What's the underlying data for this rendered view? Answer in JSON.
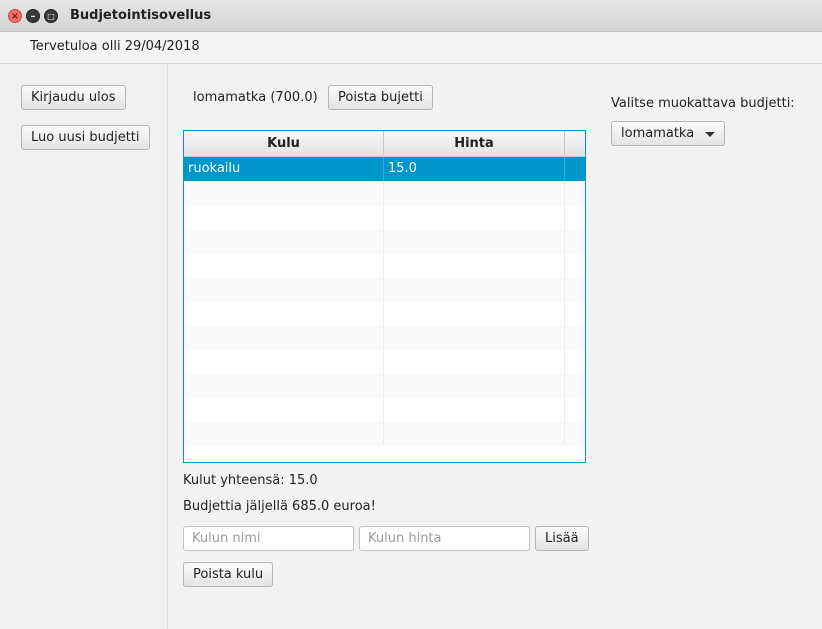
{
  "window": {
    "title": "Budjetointisovellus"
  },
  "header": {
    "welcome": "Tervetuloa olli 29/04/2018"
  },
  "sidebar": {
    "logout_label": "Kirjaudu ulos",
    "new_budget_label": "Luo uusi budjetti"
  },
  "budget": {
    "current": "lomamatka (700.0)",
    "delete_label": "Poista bujetti"
  },
  "table": {
    "columns": [
      "Kulu",
      "Hinta"
    ],
    "rows": [
      {
        "name": "ruokailu",
        "price": "15.0",
        "selected": true
      }
    ],
    "visible_rows": 12
  },
  "summary": {
    "total": "Kulut yhteensä: 15.0",
    "remaining": "Budjettia jäljellä 685.0 euroa!"
  },
  "form": {
    "name_placeholder": "Kulun nimi",
    "price_placeholder": "Kulun hinta",
    "add_label": "Lisää",
    "delete_label": "Poista kulu"
  },
  "selector": {
    "label": "Valitse muokattava budjetti:",
    "selected": "lomamatka"
  },
  "colors": {
    "accent": "#0096c9",
    "close_button": "#f26d6d"
  }
}
